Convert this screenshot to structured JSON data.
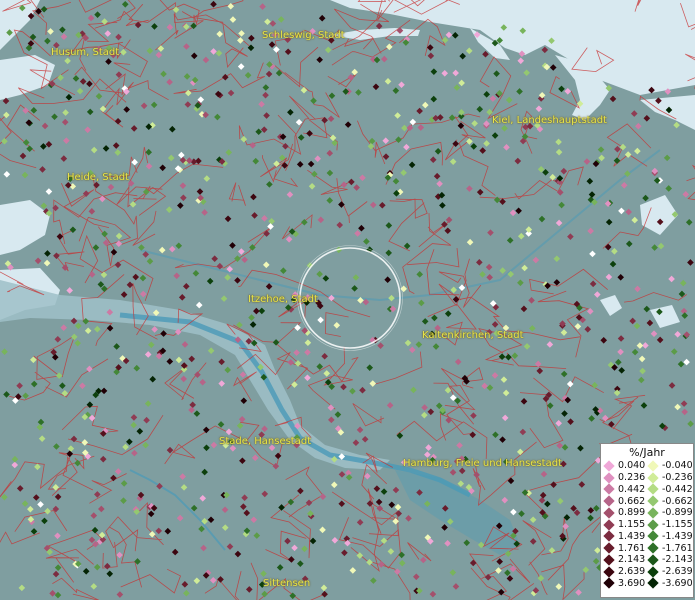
{
  "map": {
    "cities": [
      {
        "id": "husum",
        "label": "Husum, Stadt"
      },
      {
        "id": "schleswig",
        "label": "Schleswig, Stadt"
      },
      {
        "id": "kiel",
        "label": "Kiel, Landeshauptstadt"
      },
      {
        "id": "heide",
        "label": "Heide, Stadt"
      },
      {
        "id": "itzehoe",
        "label": "Itzehoe, Stadt"
      },
      {
        "id": "kaltenkirchen",
        "label": "Kaltenkirchen, Stadt"
      },
      {
        "id": "stade",
        "label": "Stade, Hansestadt"
      },
      {
        "id": "hamburg",
        "label": "Hamburg, Freie und Hansestadt"
      },
      {
        "id": "sittensen",
        "label": "Sittensen"
      }
    ],
    "colors": {
      "land": "#7f9ea0",
      "water": "#d8e9f0",
      "boundary": "#c83030",
      "river": "#4a9ab8"
    }
  },
  "legend": {
    "title": "%/Jahr",
    "positive": [
      {
        "label": "0.040",
        "color": "#f0a8d8"
      },
      {
        "label": "0.236",
        "color": "#e090c0"
      },
      {
        "label": "0.442",
        "color": "#cc7aa4"
      },
      {
        "label": "0.662",
        "color": "#b66488"
      },
      {
        "label": "0.899",
        "color": "#a4506c"
      },
      {
        "label": "1.155",
        "color": "#903c54"
      },
      {
        "label": "1.439",
        "color": "#7c2c40"
      },
      {
        "label": "1.761",
        "color": "#681c2c"
      },
      {
        "label": "2.143",
        "color": "#54101c"
      },
      {
        "label": "2.639",
        "color": "#3c0610"
      },
      {
        "label": "3.690",
        "color": "#200006"
      }
    ],
    "negative": [
      {
        "label": "-0.040",
        "color": "#f0f8b8"
      },
      {
        "label": "-0.236",
        "color": "#d0ec98"
      },
      {
        "label": "-0.442",
        "color": "#b4dc84"
      },
      {
        "label": "-0.662",
        "color": "#94c870"
      },
      {
        "label": "-0.899",
        "color": "#78b45c"
      },
      {
        "label": "-1.155",
        "color": "#5c9c48"
      },
      {
        "label": "-1.439",
        "color": "#448838"
      },
      {
        "label": "-1.761",
        "color": "#2e7028"
      },
      {
        "label": "-2.143",
        "color": "#1c581a"
      },
      {
        "label": "-2.639",
        "color": "#0c400c"
      },
      {
        "label": "-3.690",
        "color": "#042404"
      }
    ]
  }
}
